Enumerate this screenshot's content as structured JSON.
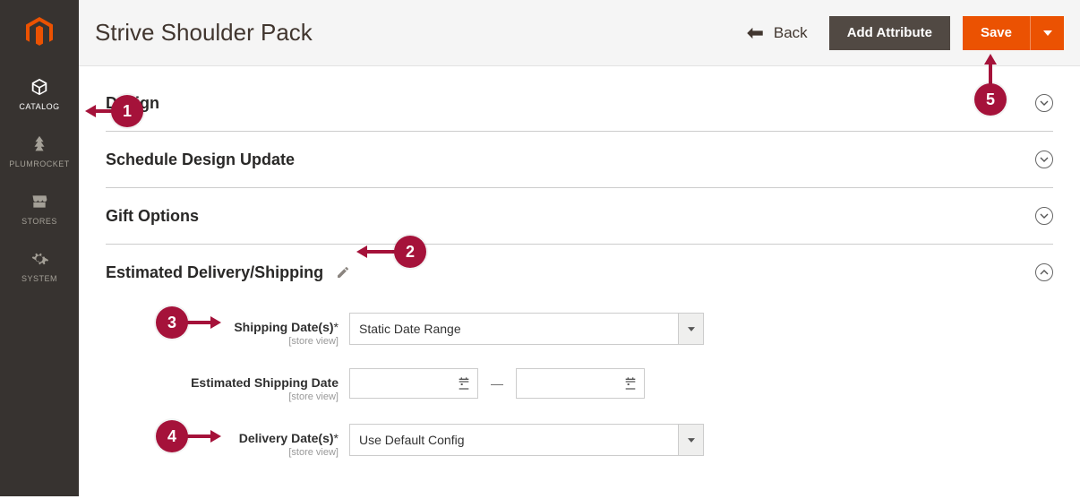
{
  "sidebar": {
    "items": [
      {
        "label": "CATALOG",
        "icon": "cube",
        "active": true
      },
      {
        "label": "PLUMROCKET",
        "icon": "tree",
        "active": false
      },
      {
        "label": "STORES",
        "icon": "storefront",
        "active": false
      },
      {
        "label": "SYSTEM",
        "icon": "gear",
        "active": false
      }
    ]
  },
  "header": {
    "title": "Strive Shoulder Pack",
    "back_label": "Back",
    "add_attribute_label": "Add Attribute",
    "save_label": "Save"
  },
  "sections": {
    "design": {
      "title": "Design"
    },
    "schedule": {
      "title": "Schedule Design Update"
    },
    "gift": {
      "title": "Gift Options"
    },
    "est": {
      "title": "Estimated Delivery/Shipping"
    }
  },
  "form": {
    "shipping_dates": {
      "label": "Shipping Date(s)",
      "scope": "[store view]",
      "required": true,
      "value": "Static Date Range"
    },
    "est_ship_date": {
      "label": "Estimated Shipping Date",
      "scope": "[store view]",
      "required": false,
      "from": "",
      "to": ""
    },
    "delivery_dates": {
      "label": "Delivery Date(s)",
      "scope": "[store view]",
      "required": true,
      "value": "Use Default Config"
    }
  },
  "callouts": {
    "1": "1",
    "2": "2",
    "3": "3",
    "4": "4",
    "5": "5"
  }
}
